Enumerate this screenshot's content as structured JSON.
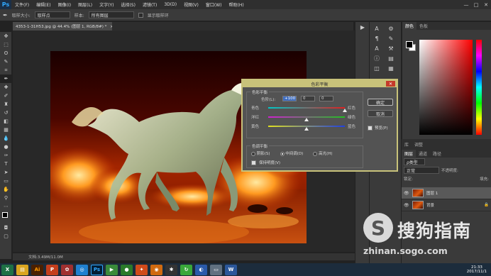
{
  "menubar": {
    "logo": "Ps",
    "items": [
      "文件(F)",
      "编辑(E)",
      "图像(I)",
      "图层(L)",
      "文字(Y)",
      "选择(S)",
      "滤镜(T)",
      "3D(D)",
      "视图(V)",
      "窗口(W)",
      "帮助(H)"
    ],
    "minimize": "—",
    "maximize": "□",
    "close": "✕"
  },
  "options": {
    "sample_size_label": "取样大小:",
    "sample_size_value": "取样点",
    "sample_label": "样本:",
    "sample_value": "所有图层",
    "show_ring_label": "显示取样环"
  },
  "document": {
    "tab": "4353-1-31H53.jpg @ 44.4% (图层 1, RGB/8#) *",
    "tab_close": "×",
    "status": "文档:3.49M/11.0M"
  },
  "color_panel": {
    "tabs": [
      "颜色",
      "色板"
    ]
  },
  "adjust_panel": {
    "tabs": [
      "库",
      "调整"
    ]
  },
  "layers_panel": {
    "tabs": [
      "图层",
      "通道",
      "路径"
    ],
    "kind_label": "ρ类型",
    "blend_mode": "正常",
    "opacity_label": "不透明度:",
    "lock_label": "锁定:",
    "fill_label": "填充:",
    "layers": [
      {
        "name": "图层 1",
        "selected": true
      },
      {
        "name": "背景",
        "selected": false
      }
    ]
  },
  "dialog": {
    "title": "色彩平衡",
    "close": "✕",
    "section1": "色彩平衡",
    "levels_label": "色阶(L):",
    "levels": [
      "+100",
      "0",
      "0"
    ],
    "sliders": [
      {
        "left": "青色",
        "right": "红色",
        "position": 1.0
      },
      {
        "left": "洋红",
        "right": "绿色",
        "position": 0.5
      },
      {
        "left": "黄色",
        "right": "蓝色",
        "position": 0.5
      }
    ],
    "section2": "色调平衡",
    "tones": [
      "阴影(S)",
      "中间调(D)",
      "高光(H)"
    ],
    "selected_tone": 1,
    "preserve_label": "保持明度(V)",
    "ok": "确定",
    "cancel": "取消",
    "preview_label": "预览(P)"
  },
  "taskbar": {
    "icons": [
      "X",
      "▤",
      "Ai",
      "P",
      "✿",
      "◎",
      "Ps",
      "▶",
      "●",
      "✦",
      "◉",
      "✱",
      "↻",
      "◐",
      "▭",
      "W"
    ],
    "time": "21:33",
    "date": "2017/11/1"
  },
  "watermark": {
    "title": "搜狗指南",
    "url": "zhinan.sogo.com",
    "logo": "S"
  }
}
